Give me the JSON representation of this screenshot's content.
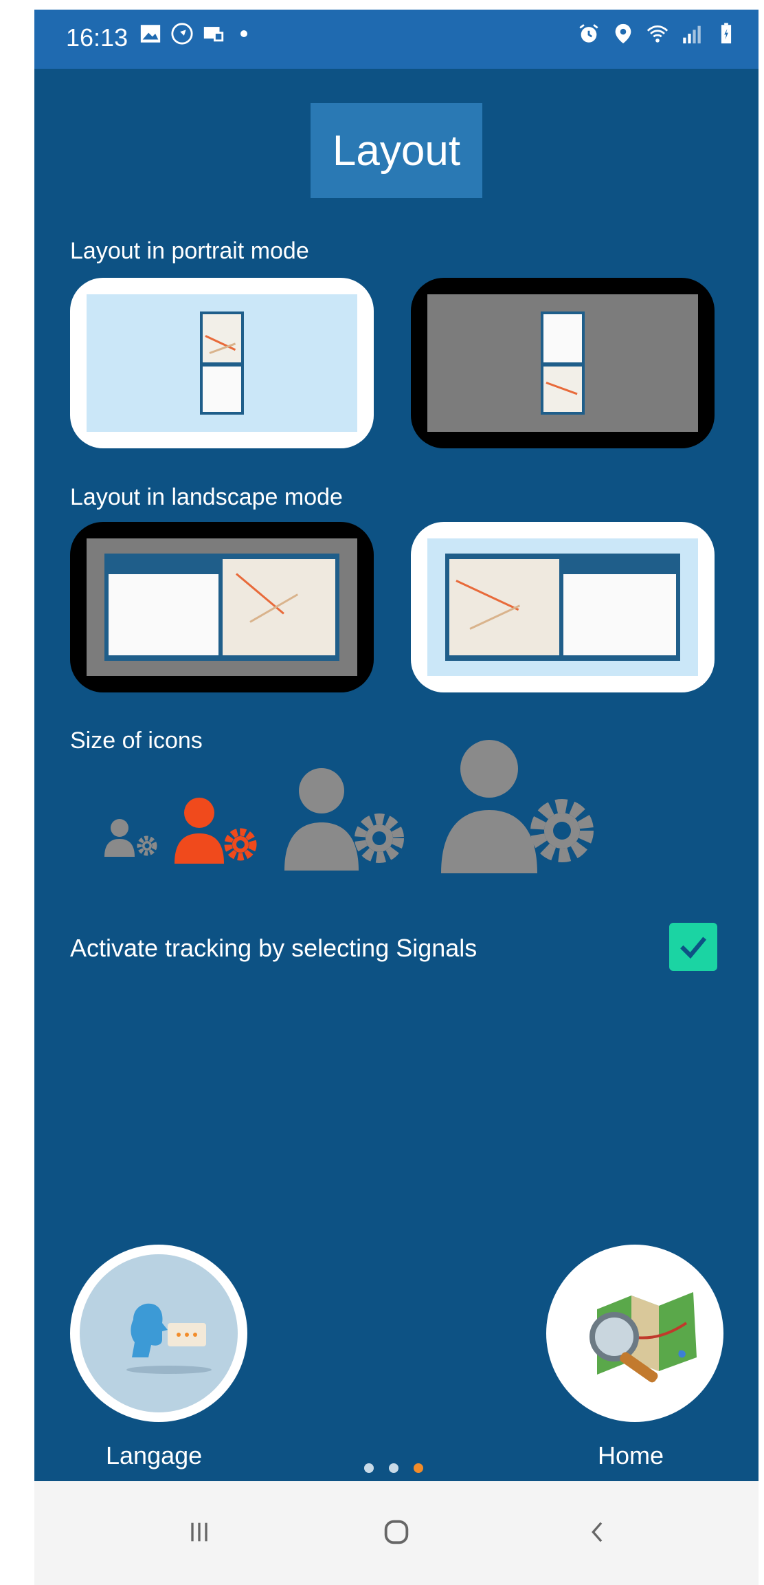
{
  "status_bar": {
    "time": "16:13",
    "left_icons": [
      "gallery-icon",
      "navigation-icon",
      "message-icon"
    ],
    "right_icons": [
      "alarm-icon",
      "location-icon",
      "wifi-icon",
      "signal-icon",
      "battery-icon"
    ]
  },
  "header": {
    "title": "Layout"
  },
  "sections": {
    "portrait_label": "Layout in portrait mode",
    "landscape_label": "Layout in landscape mode",
    "icons_label": "Size of icons"
  },
  "tracking": {
    "label": "Activate tracking by selecting Signals",
    "checked": true
  },
  "bottom": {
    "language_label": "Langage",
    "home_label": "Home"
  },
  "pager": {
    "total": 3,
    "active_index": 2
  },
  "colors": {
    "background": "#0d5284",
    "status_bar": "#1f6ab0",
    "title_box": "#2a79b4",
    "accent_orange": "#f04a1c",
    "icon_gray": "#8a8a8a",
    "checkbox": "#1bd4a3",
    "pager_active": "#f28c2a"
  },
  "navbar_icons": [
    "recent-apps-icon",
    "home-circle-icon",
    "back-icon"
  ]
}
